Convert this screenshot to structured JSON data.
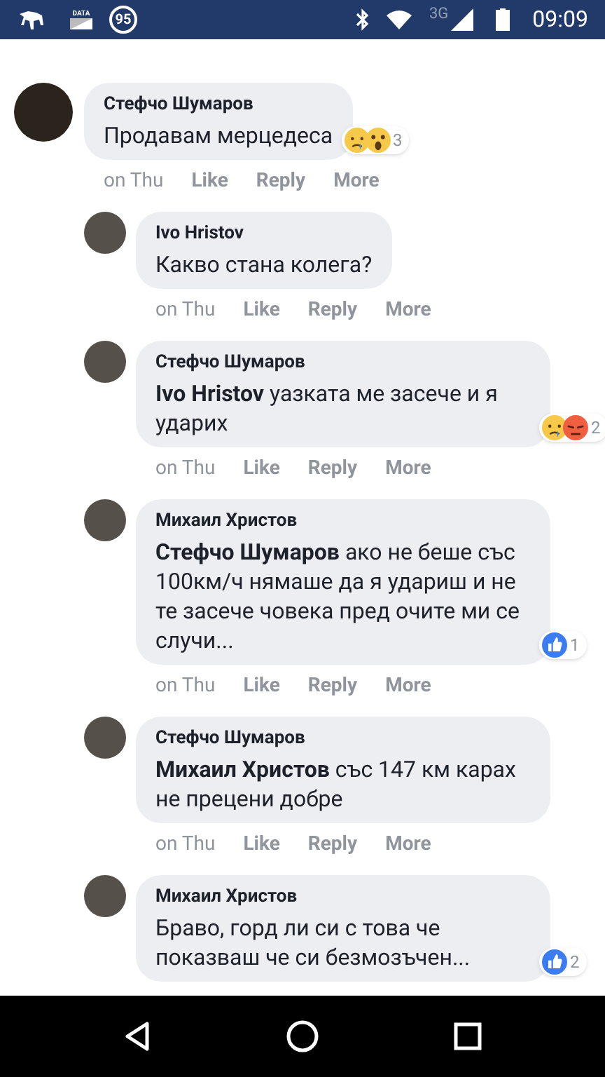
{
  "status_bar": {
    "data_label": "DATA",
    "badge": "95",
    "network": "3G",
    "time": "09:09"
  },
  "comments": [
    {
      "author": "Стефчо Шумаров",
      "text": "Продавам мерцедеса",
      "reactions": {
        "icons": [
          {
            "kind": "sad"
          },
          {
            "kind": "wow"
          }
        ],
        "count": "3"
      },
      "time": "on Thu",
      "actions": [
        "Like",
        "Reply",
        "More"
      ],
      "children": [
        {
          "author": "Ivo Hristov",
          "text": "Какво стана колега?",
          "time": "on Thu",
          "actions": [
            "Like",
            "Reply",
            "More"
          ]
        },
        {
          "author": "Стефчо Шумаров",
          "text": "**Ivo Hristov** уазката ме засече и я ударих",
          "reactions": {
            "icons": [
              {
                "kind": "sad"
              },
              {
                "kind": "angry"
              }
            ],
            "count": "2"
          },
          "time": "on Thu",
          "actions": [
            "Like",
            "Reply",
            "More"
          ]
        },
        {
          "author": "Михаил Христов",
          "text": "**Стефчо Шумаров** ако не беше със 100км/ч нямаше да я удариш и не те засече човека пред очите ми се случи...",
          "reactions": {
            "icons": [
              {
                "kind": "like"
              }
            ],
            "count": "1"
          },
          "time": "on Thu",
          "actions": [
            "Like",
            "Reply",
            "More"
          ]
        },
        {
          "author": "Стефчо Шумаров",
          "text": "**Михаил Христов** със 147 км карах не прецени добре",
          "time": "on Thu",
          "actions": [
            "Like",
            "Reply",
            "More"
          ]
        },
        {
          "author": "Михаил Христов",
          "text": "Браво, горд ли си с това че показваш че си безмозъчен...",
          "reactions": {
            "icons": [
              {
                "kind": "like"
              }
            ],
            "count": "2"
          }
        }
      ]
    }
  ]
}
